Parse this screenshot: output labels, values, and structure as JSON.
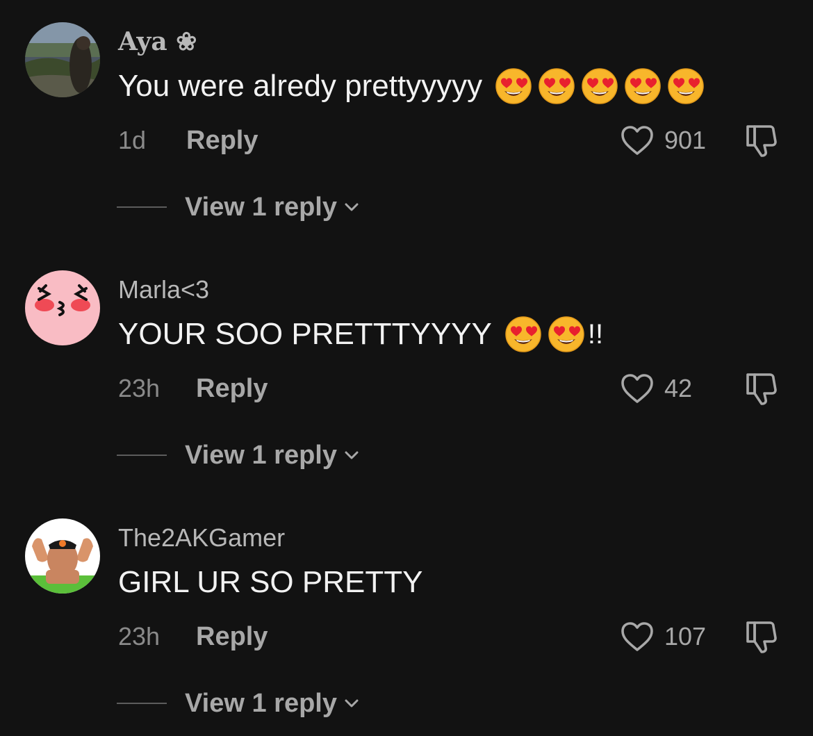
{
  "comments": [
    {
      "username": "Aya ❀",
      "text": "You were alredy prettyyyyy",
      "emoji_count": 5,
      "suffix": "",
      "time": "1d",
      "reply_label": "Reply",
      "likes": "901",
      "view_replies": "View 1 reply",
      "avatar": "landscape-photo"
    },
    {
      "username": "Marla<3",
      "text": "YOUR SOO PRETTTYYYY",
      "emoji_count": 2,
      "suffix": "!!",
      "time": "23h",
      "reply_label": "Reply",
      "likes": "42",
      "view_replies": "View 1 reply",
      "avatar": "pink-kissing-face"
    },
    {
      "username": "The2AKGamer",
      "text": "GIRL UR SO PRETTY",
      "emoji_count": 0,
      "suffix": "",
      "time": "23h",
      "reply_label": "Reply",
      "likes": "107",
      "view_replies": "View 1 reply",
      "avatar": "flexing-man-photo"
    }
  ],
  "icons": {
    "like": "heart-outline-icon",
    "dislike": "thumbs-down-outline-icon",
    "expand": "chevron-down-icon",
    "emoji": "heart-eyes-emoji"
  },
  "colors": {
    "background": "#121212",
    "text_primary": "#f2f2f2",
    "text_secondary": "#a8a8a8"
  }
}
